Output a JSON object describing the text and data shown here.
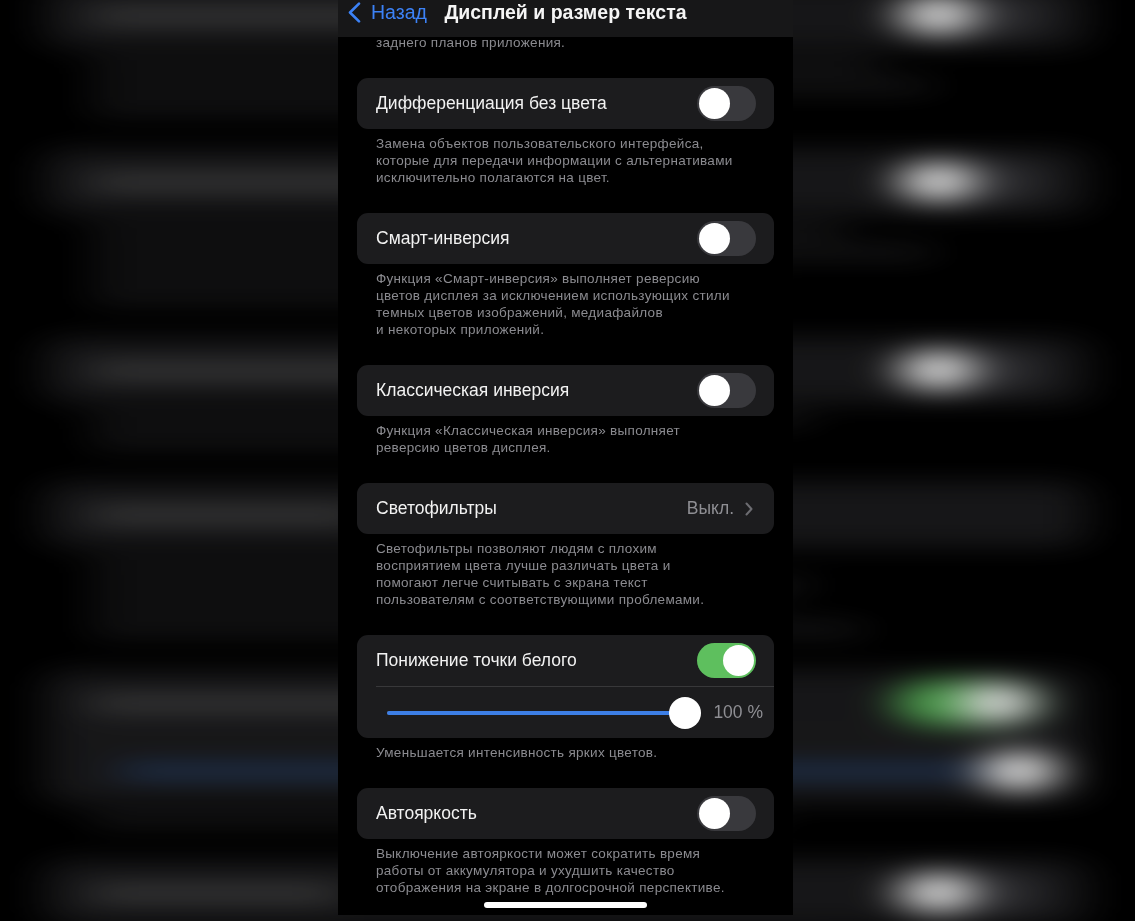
{
  "nav_bar": {
    "back_label": "Назад",
    "title": "Дисплей и размер текста"
  },
  "partial_footer": "заднего планов приложения.",
  "sections": [
    {
      "rows": [
        {
          "kind": "toggle",
          "label": "Дифференциация без цвета",
          "on": false
        }
      ],
      "footer": "Замена объектов пользовательского интерфейса,\nкоторые для передачи информации с альтернативами\nисключительно полагаются на цвет."
    },
    {
      "rows": [
        {
          "kind": "toggle",
          "label": "Смарт-инверсия",
          "on": false
        }
      ],
      "footer": "Функция «Смарт-инверсия» выполняет реверсию\nцветов дисплея за исключением использующих стили\nтемных цветов изображений, медиафайлов\nи некоторых приложений."
    },
    {
      "rows": [
        {
          "kind": "toggle",
          "label": "Классическая инверсия",
          "on": false
        }
      ],
      "footer": "Функция «Классическая инверсия» выполняет\nреверсию цветов дисплея."
    },
    {
      "rows": [
        {
          "kind": "disclosure",
          "label": "Светофильтры",
          "value": "Выкл."
        }
      ],
      "footer": "Светофильтры позволяют людям с плохим\nвосприятием цвета лучше различать цвета и\nпомогают легче считывать с экрана текст\nпользователям с соответствующими проблемами."
    },
    {
      "rows": [
        {
          "kind": "toggle",
          "label": "Понижение точки белого",
          "on": true
        },
        {
          "kind": "slider",
          "level": 1,
          "reading": "100 %"
        }
      ],
      "footer": "Уменьшается интенсивность ярких цветов."
    },
    {
      "rows": [
        {
          "kind": "toggle",
          "label": "Автояркость",
          "on": false
        }
      ],
      "footer": "Выключение автояркости может сократить время\nработы от аккумулятора и ухудшить качество\nотображения на экране в долгосрочной перспективе."
    }
  ]
}
